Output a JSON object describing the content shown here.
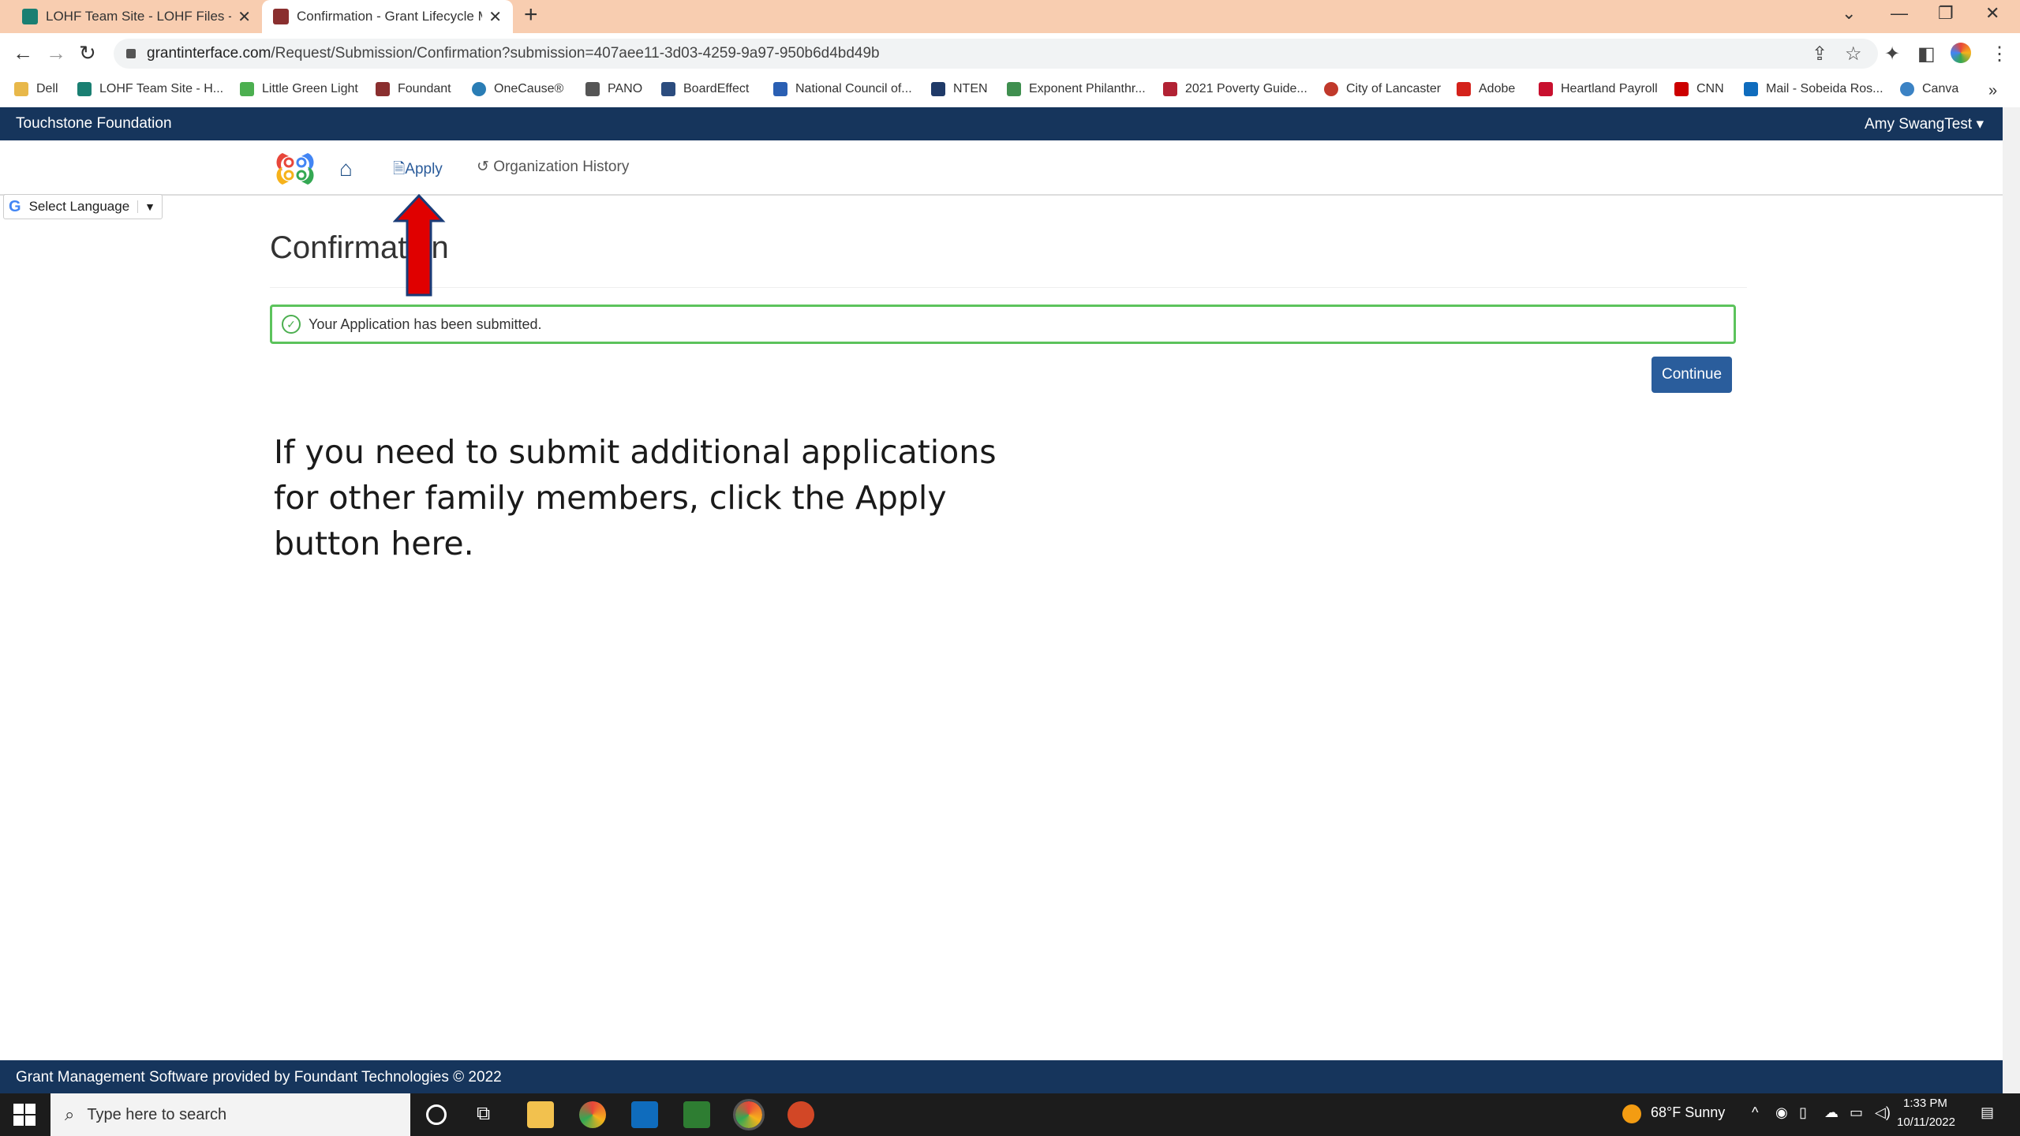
{
  "browser": {
    "tabs": [
      {
        "title": "LOHF Team Site - LOHF Files - All",
        "favicon_color": "#1a7f72"
      },
      {
        "title": "Confirmation - Grant Lifecycle M",
        "favicon_color": "#8a2f2f"
      }
    ],
    "url_domain": "grantinterface.com",
    "url_path": "/Request/Submission/Confirmation?submission=407aee11-3d03-4259-9a97-950b6d4bd49b",
    "bookmarks": [
      {
        "label": "Dell",
        "color": "#e8b84a"
      },
      {
        "label": "LOHF Team Site - H...",
        "color": "#1a7f72"
      },
      {
        "label": "Little Green Light",
        "color": "#4caf50"
      },
      {
        "label": "Foundant",
        "color": "#8a2f2f"
      },
      {
        "label": "OneCause®",
        "color": "#2a7db5"
      },
      {
        "label": "PANO",
        "color": "#555555"
      },
      {
        "label": "BoardEffect",
        "color": "#2b4c7e"
      },
      {
        "label": "National Council of...",
        "color": "#2a5fb3"
      },
      {
        "label": "NTEN",
        "color": "#1f3a68"
      },
      {
        "label": "Exponent Philanthr...",
        "color": "#3f8f4f"
      },
      {
        "label": "2021 Poverty Guide...",
        "color": "#b22234"
      },
      {
        "label": "City of Lancaster",
        "color": "#c0392b"
      },
      {
        "label": "Adobe",
        "color": "#d4221b"
      },
      {
        "label": "Heartland Payroll",
        "color": "#c8102e"
      },
      {
        "label": "CNN",
        "color": "#cc0000"
      },
      {
        "label": "Mail - Sobeida Ros...",
        "color": "#0f6cbd"
      },
      {
        "label": "Canva",
        "color": "#3b82c4"
      }
    ]
  },
  "site": {
    "org_name": "Touchstone Foundation",
    "user": "Amy SwangTest",
    "nav": {
      "apply": "Apply",
      "org_history": "Organization History"
    },
    "language": "Select Language"
  },
  "page": {
    "title": "Confirmation",
    "alert": "Your Application has been submitted.",
    "continue": "Continue"
  },
  "annotation": {
    "note": "If you need to submit additional applications for other family members, click the Apply button here."
  },
  "footer": "Grant Management Software provided by Foundant Technologies © 2022",
  "taskbar": {
    "search_placeholder": "Type here to search",
    "weather": "68°F  Sunny",
    "time": "1:33 PM",
    "date": "10/11/2022"
  }
}
